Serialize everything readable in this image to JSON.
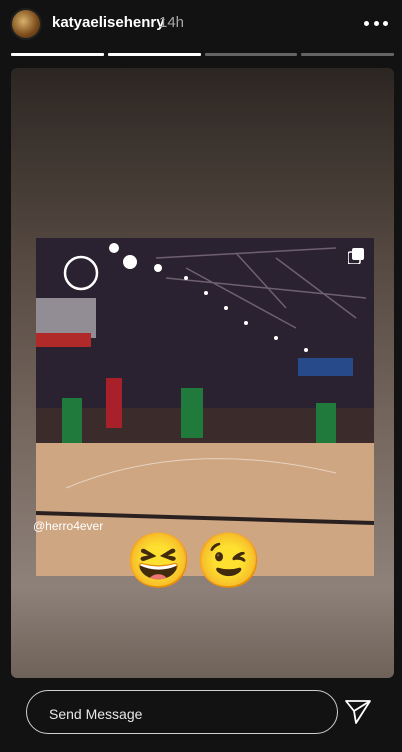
{
  "header": {
    "username": "katyaelisehenry",
    "time": "14h",
    "more_icon": "more-horizontal-icon"
  },
  "progress": {
    "segments_total": 4,
    "segments_complete": 1,
    "current_segment": 2
  },
  "story": {
    "media_type": "video",
    "multi_icon": "carousel-icon",
    "caption": "@herro4ever",
    "emojis": [
      "😆",
      "😉"
    ]
  },
  "reply": {
    "placeholder": "Send Message",
    "send_icon": "paper-plane-icon"
  }
}
